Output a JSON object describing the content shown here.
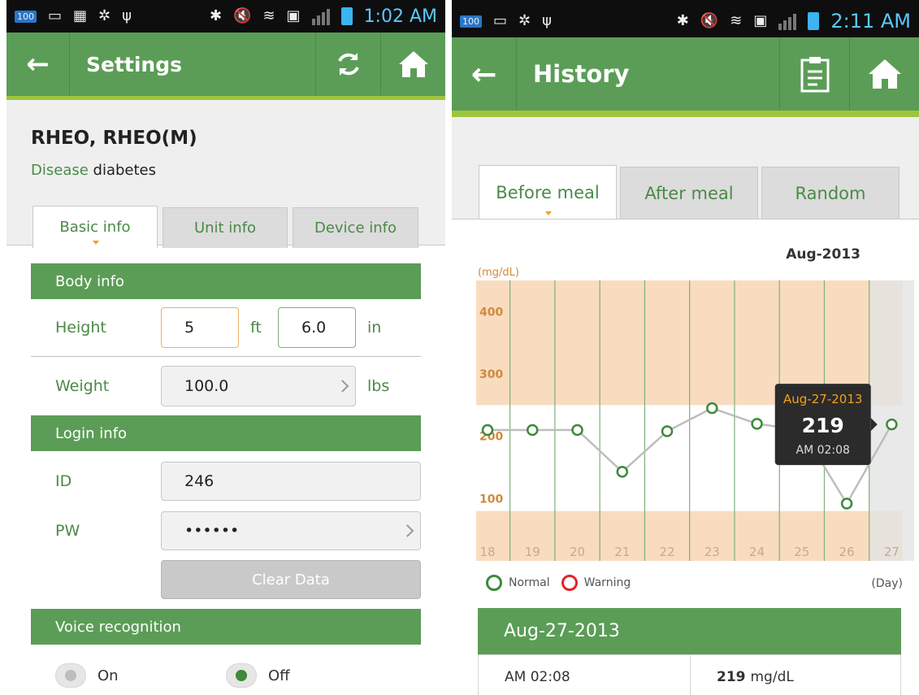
{
  "left": {
    "status": {
      "time": "1:02 AM",
      "battery_badge": "100"
    },
    "appbar": {
      "title": "Settings"
    },
    "patient": {
      "name": "RHEO, RHEO(M)",
      "disease_label": "Disease",
      "disease_value": "diabetes"
    },
    "tabs": [
      {
        "label": "Basic info",
        "active": true
      },
      {
        "label": "Unit info",
        "active": false
      },
      {
        "label": "Device info",
        "active": false
      }
    ],
    "body_info": {
      "section": "Body info",
      "height_label": "Height",
      "height_ft": "5",
      "ft_unit": "ft",
      "height_in": "6.0",
      "in_unit": "in",
      "weight_label": "Weight",
      "weight_value": "100.0",
      "weight_unit": "lbs"
    },
    "login_info": {
      "section": "Login info",
      "id_label": "ID",
      "id_value": "246",
      "pw_label": "PW",
      "pw_value": "••••••",
      "clear_button": "Clear Data"
    },
    "voice": {
      "section": "Voice recognition",
      "on_label": "On",
      "off_label": "Off",
      "selected": "Off"
    }
  },
  "right": {
    "status": {
      "time": "2:11 AM",
      "battery_badge": "100"
    },
    "appbar": {
      "title": "History"
    },
    "tabs": [
      {
        "label": "Before meal",
        "active": true
      },
      {
        "label": "After meal",
        "active": false
      },
      {
        "label": "Random",
        "active": false
      }
    ],
    "month": "Aug-2013",
    "legend": {
      "normal": "Normal",
      "warning": "Warning",
      "unit": "(Day)"
    },
    "tooltip": {
      "date": "Aug-27-2013",
      "value": "219",
      "time": "AM 02:08"
    },
    "detail": {
      "header": "Aug-27-2013",
      "time": "AM 02:08",
      "value": "219",
      "unit": "mg/dL"
    }
  },
  "chart_data": {
    "type": "line",
    "title": "",
    "xlabel": "(Day)",
    "ylabel": "(mg/dL)",
    "x": [
      "18",
      "19",
      "20",
      "21",
      "22",
      "23",
      "24",
      "25",
      "26",
      "27"
    ],
    "yticks": [
      "100",
      "200",
      "300",
      "400"
    ],
    "ylim": [
      0,
      450
    ],
    "series": [
      {
        "name": "",
        "values": [
          210,
          210,
          210,
          143,
          208,
          245,
          220,
          210,
          92,
          219
        ]
      }
    ],
    "normal_range": [
      80,
      250
    ],
    "selected_point": {
      "x": "27",
      "y": 219
    },
    "colors": {
      "line": "#bdbdbd",
      "point": "#3c8a3a",
      "out_band": "#f9dcc0",
      "selected_col": "#e3e3e3"
    },
    "legend_position": "bottom-left"
  }
}
